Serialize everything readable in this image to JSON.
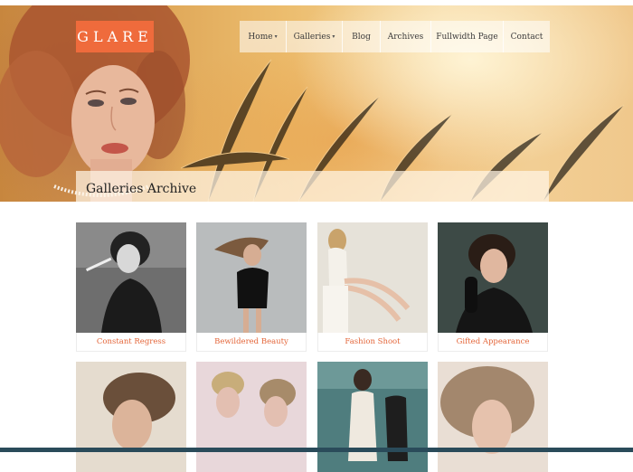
{
  "brand": {
    "logo": "GLARE",
    "accent": "#ef6b3c"
  },
  "nav": {
    "items": [
      {
        "label": "Home",
        "has_submenu": true
      },
      {
        "label": "Galleries",
        "has_submenu": true
      },
      {
        "label": "Blog",
        "has_submenu": false
      },
      {
        "label": "Archives",
        "has_submenu": false
      },
      {
        "label": "Fullwidth Page",
        "has_submenu": false
      },
      {
        "label": "Contact",
        "has_submenu": false
      }
    ],
    "caret": "▾"
  },
  "page": {
    "title": "Galleries Archive"
  },
  "gallery": {
    "items": [
      {
        "title": "Constant Regress",
        "image": "bw-woman-smoking"
      },
      {
        "title": "Bewildered Beauty",
        "image": "woman-black-dress-hair-flying"
      },
      {
        "title": "Fashion Shoot",
        "image": "blonde-seated-white-dress"
      },
      {
        "title": "Gifted Appearance",
        "image": "vintage-woman-black-gloves"
      },
      {
        "title": "",
        "image": "braided-hair-profile"
      },
      {
        "title": "",
        "image": "two-women-flower-crowns"
      },
      {
        "title": "",
        "image": "two-women-teal-room"
      },
      {
        "title": "",
        "image": "woman-voluminous-hair"
      }
    ]
  }
}
